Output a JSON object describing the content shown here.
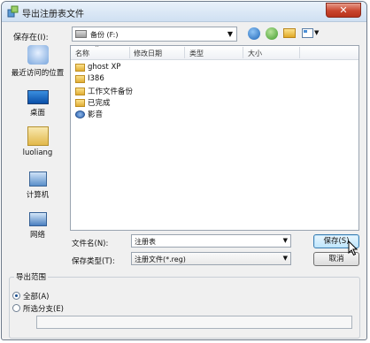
{
  "window": {
    "title": "导出注册表文件",
    "close_glyph": "✕"
  },
  "toolbar": {
    "save_in_label": "保存在(I):",
    "location": "备份 (F:)",
    "back_icon": "back-arrow-icon",
    "up_icon": "up-folder-icon",
    "new_folder_icon": "new-folder-icon",
    "view_menu_icon": "view-menu-icon"
  },
  "places": [
    {
      "label": "最近访问的位置",
      "icon": "recent-places-icon"
    },
    {
      "label": "桌面",
      "icon": "desktop-icon"
    },
    {
      "label": "luoliang",
      "icon": "user-folder-icon"
    },
    {
      "label": "计算机",
      "icon": "computer-icon"
    },
    {
      "label": "网络",
      "icon": "network-icon"
    }
  ],
  "file_list": {
    "columns": [
      "名称",
      "修改日期",
      "类型",
      "大小"
    ],
    "items": [
      {
        "name": "ghost XP",
        "kind": "folder"
      },
      {
        "name": "I386",
        "kind": "folder"
      },
      {
        "name": "工作文件备份",
        "kind": "folder"
      },
      {
        "name": "已完成",
        "kind": "folder"
      },
      {
        "name": "影音",
        "kind": "media"
      }
    ]
  },
  "filename": {
    "label": "文件名(N):",
    "value": "注册表"
  },
  "filetype": {
    "label": "保存类型(T):",
    "value": "注册文件(*.reg)"
  },
  "buttons": {
    "save": "保存(S)",
    "cancel": "取消"
  },
  "export_range": {
    "title": "导出范围",
    "options": [
      {
        "label": "全部(A)",
        "selected": true
      },
      {
        "label": "所选分支(E)",
        "selected": false
      }
    ],
    "branch_value": ""
  }
}
